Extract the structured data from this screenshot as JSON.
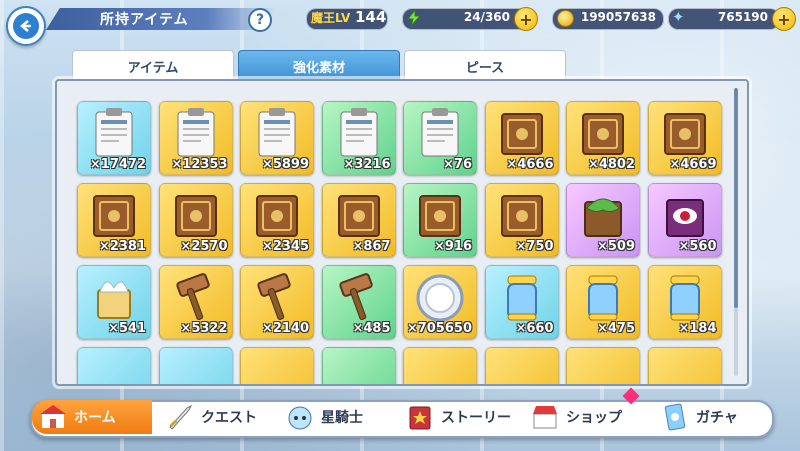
{
  "header": {
    "title": "所持アイテム",
    "help": "?",
    "level_label": "魔王LV",
    "level_value": "144",
    "stamina": "24/360",
    "coins": "199057638",
    "gems": "765190",
    "plus": "+"
  },
  "tabs": [
    {
      "label": "アイテム",
      "active": false
    },
    {
      "label": "強化素材",
      "active": true
    },
    {
      "label": "ピース",
      "active": false
    }
  ],
  "items": [
    {
      "icon": "report-icon",
      "bg": "teal",
      "count": "×17472"
    },
    {
      "icon": "report-icon",
      "bg": "gold",
      "count": "×12353"
    },
    {
      "icon": "report-icon",
      "bg": "gold",
      "count": "×5899"
    },
    {
      "icon": "report-icon",
      "bg": "green",
      "count": "×3216"
    },
    {
      "icon": "report-icon",
      "bg": "green",
      "count": "×76"
    },
    {
      "icon": "book-icon",
      "bg": "gold",
      "count": "×4666"
    },
    {
      "icon": "book-icon",
      "bg": "gold",
      "count": "×4802"
    },
    {
      "icon": "book-icon",
      "bg": "gold",
      "count": "×4669"
    },
    {
      "icon": "book-icon",
      "bg": "gold",
      "count": "×2381"
    },
    {
      "icon": "book-icon",
      "bg": "gold",
      "count": "×2570"
    },
    {
      "icon": "book-icon",
      "bg": "gold",
      "count": "×2345"
    },
    {
      "icon": "book-icon",
      "bg": "gold",
      "count": "×867"
    },
    {
      "icon": "book-icon",
      "bg": "green",
      "count": "×916"
    },
    {
      "icon": "book-icon",
      "bg": "gold",
      "count": "×750"
    },
    {
      "icon": "leaf-book-icon",
      "bg": "pink",
      "count": "×509"
    },
    {
      "icon": "eye-book-icon",
      "bg": "pink",
      "count": "×560"
    },
    {
      "icon": "wing-book-icon",
      "bg": "teal",
      "count": "×541"
    },
    {
      "icon": "hammer-icon",
      "bg": "gold",
      "count": "×5322"
    },
    {
      "icon": "hammer-icon",
      "bg": "gold",
      "count": "×2140"
    },
    {
      "icon": "hammer-icon",
      "bg": "green",
      "count": "×485"
    },
    {
      "icon": "medal-icon",
      "bg": "gold",
      "count": "×705650"
    },
    {
      "icon": "jar-icon",
      "bg": "teal",
      "count": "×660"
    },
    {
      "icon": "jar-icon",
      "bg": "gold",
      "count": "×475"
    },
    {
      "icon": "jar-icon",
      "bg": "gold",
      "count": "×184"
    }
  ],
  "partial_row_bgs": [
    "teal",
    "teal",
    "gold",
    "green",
    "gold",
    "gold",
    "gold",
    "gold"
  ],
  "nav": [
    {
      "label": "ホーム",
      "icon": "home-icon"
    },
    {
      "label": "クエスト",
      "icon": "sword-icon"
    },
    {
      "label": "星騎士",
      "icon": "knight-icon"
    },
    {
      "label": "ストーリー",
      "icon": "story-book-icon"
    },
    {
      "label": "ショップ",
      "icon": "shop-icon"
    },
    {
      "label": "ガチャ",
      "icon": "gacha-card-icon"
    }
  ]
}
